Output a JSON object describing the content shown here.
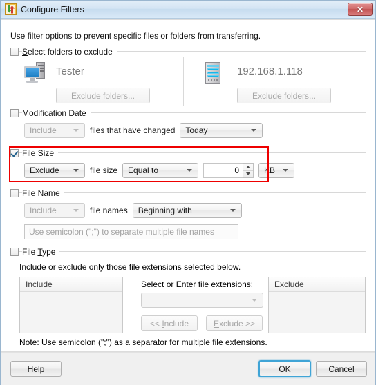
{
  "window": {
    "title": "Configure Filters",
    "icon": "file-transfer-icon",
    "close_label": "✕"
  },
  "intro": "Use filter options to prevent specific files or folders from transferring.",
  "sections": {
    "select_folders": {
      "label_pre": "",
      "label_accel": "S",
      "label_post": "elect folders to exclude",
      "checked": false,
      "local": {
        "icon": "desktop-computer-icon",
        "name": "Tester",
        "button_pre": "E",
        "button_accel": "x",
        "button_post": "clude folders...",
        "button_label": "Exclude folders...",
        "button_enabled": false
      },
      "remote": {
        "icon": "server-icon",
        "name": "192.168.1.118",
        "button_label": "Exclude folders...",
        "button_enabled": false
      }
    },
    "modification_date": {
      "label_pre": "",
      "label_accel": "M",
      "label_post": "odification Date",
      "checked": false,
      "mode": "Include",
      "middle_text": "files that have changed",
      "when": "Today",
      "enabled": false
    },
    "file_size": {
      "label_pre": "",
      "label_accel": "F",
      "label_post": "ile Size",
      "checked": true,
      "highlighted": true,
      "mode": "Exclude",
      "middle_text": "file size",
      "comparison": "Equal to",
      "value": "0",
      "unit": "KB",
      "enabled": true
    },
    "file_name": {
      "label_pre": "File ",
      "label_accel": "N",
      "label_post": "ame",
      "checked": false,
      "mode": "Include",
      "middle_text": "file names",
      "match": "Beginning with",
      "placeholder": "Use semicolon (\";\") to separate multiple file names",
      "enabled": false
    },
    "file_type": {
      "label_pre": "File ",
      "label_accel": "T",
      "label_post": "ype",
      "checked": false,
      "description": "Include or exclude only those file extensions selected below.",
      "include_header": "Include",
      "exclude_header": "Exclude",
      "include_items": [],
      "exclude_items": [],
      "select_label_pre": "Select ",
      "select_label_accel": "o",
      "select_label_post": "r Enter file extensions:",
      "extensions_value": "",
      "include_button_pre": "<< ",
      "include_button_accel": "I",
      "include_button_post": "nclude",
      "exclude_button_pre": "",
      "exclude_button_accel": "E",
      "exclude_button_post": "xclude >>",
      "note": "Note: Use semicolon (\";\") as a separator for multiple file extensions."
    }
  },
  "footer": {
    "help_label": "Help",
    "ok_label": "OK",
    "cancel_label": "Cancel"
  },
  "colors": {
    "highlight": "#ee0000",
    "title_bar": "#cde0f0",
    "close_button": "#c25353",
    "default_focus": "#3fa4d6"
  }
}
